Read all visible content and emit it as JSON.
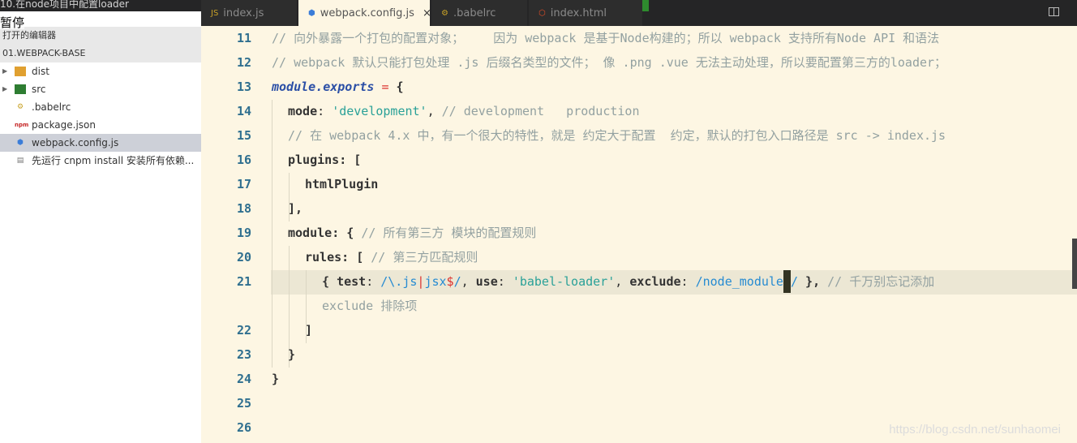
{
  "window": {
    "title_fragment": "10.在node项目中配置loader"
  },
  "tabs": [
    {
      "label": "index.js",
      "icon": "js-file-icon"
    },
    {
      "label": "webpack.config.js",
      "icon": "webpack-file-icon",
      "active": true,
      "close": "×"
    },
    {
      "label": ".babelrc",
      "icon": "babelrc-file-icon"
    },
    {
      "label": "index.html",
      "icon": "html-file-icon"
    }
  ],
  "sidebar": {
    "overlay": "暂停",
    "open_editors": "打开的编辑器",
    "project": "01.WEBPACK-BASE",
    "items": [
      {
        "label": "dist",
        "type": "folder"
      },
      {
        "label": "src",
        "type": "folder"
      },
      {
        "label": ".babelrc",
        "type": "file"
      },
      {
        "label": "package.json",
        "type": "file"
      },
      {
        "label": "webpack.config.js",
        "type": "file",
        "selected": true
      },
      {
        "label": "先运行 cnpm install 安装所有依赖...",
        "type": "file"
      }
    ]
  },
  "editor": {
    "line_numbers": [
      "11",
      "12",
      "13",
      "14",
      "15",
      "16",
      "17",
      "18",
      "19",
      "20",
      "21",
      "22",
      "23",
      "24",
      "25",
      "26"
    ],
    "lines": {
      "l11": "// 向外暴露一个打包的配置对象；    因为 webpack 是基于Node构建的；所以 webpack 支持所有Node API 和语法",
      "l12": "// webpack 默认只能打包处理 .js 后缀名类型的文件； 像 .png .vue 无法主动处理，所以要配置第三方的loader；",
      "l13_kw": "module.exports",
      "l13_op": " = ",
      "l13_rest": "{",
      "l14_key": "mode",
      "l14_colon": ": ",
      "l14_str": "'development'",
      "l14_comma": ", ",
      "l14_cm": "// development   production",
      "l15": "// 在 webpack 4.x 中，有一个很大的特性，就是 约定大于配置  约定，默认的打包入口路径是 src -> index.js",
      "l16_key": "plugins",
      "l16_rest": ": [",
      "l17": "htmlPlugin",
      "l18": "],",
      "l19_key": "module",
      "l19_rest": ": { ",
      "l19_cm": "// 所有第三方 模块的配置规则",
      "l20_key": "rules",
      "l20_rest": ": [ ",
      "l20_cm": "// 第三方匹配规则",
      "l21_a": "{ ",
      "l21_test": "test",
      "l21_b": ": ",
      "l21_rx1": "/\\.js",
      "l21_pipe": "|",
      "l21_rx2": "jsx",
      "l21_dollar": "$",
      "l21_rx3": "/",
      "l21_c": ", ",
      "l21_use": "use",
      "l21_d": ": ",
      "l21_str": "'babel-loader'",
      "l21_e": ", ",
      "l21_excl": "exclude",
      "l21_f": ": ",
      "l21_rx4": "/node_module",
      "l21_rx5": "s/",
      "l21_g": " }, ",
      "l21_cm": "// 千万别忘记添加",
      "l21_wrap": "exclude 排除项",
      "l22": "]",
      "l23": "}",
      "l24": "}"
    },
    "watermark": "https://blog.csdn.net/sunhaomei"
  }
}
